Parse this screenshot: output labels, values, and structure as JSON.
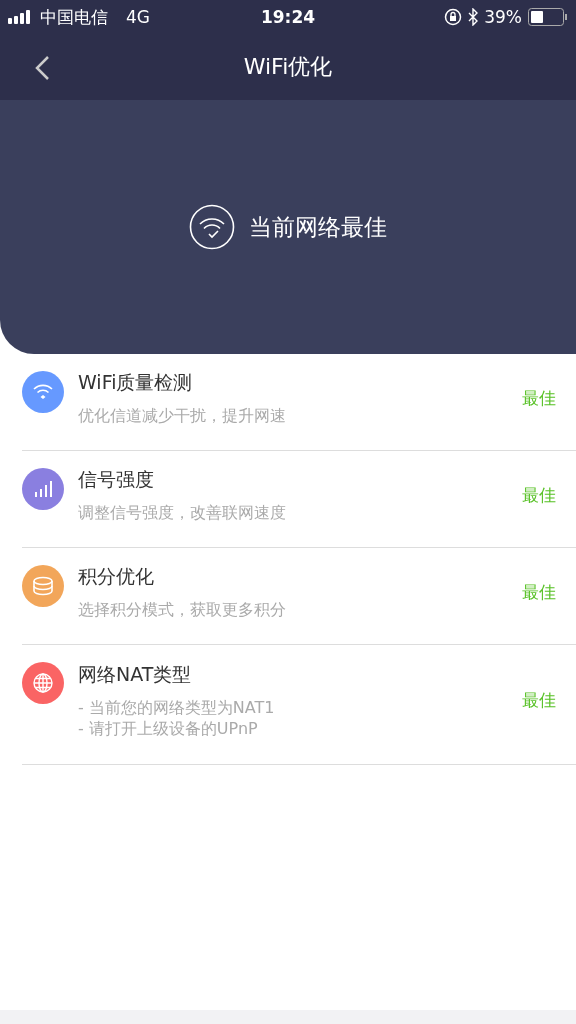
{
  "status_bar": {
    "carrier": "中国电信",
    "network": "4G",
    "time": "19:24",
    "battery": "39%"
  },
  "nav": {
    "title": "WiFi优化"
  },
  "hero": {
    "message": "当前网络最佳"
  },
  "items": [
    {
      "kind": "wifi",
      "color": "#6699ff",
      "title": "WiFi质量检测",
      "lines": [
        "优化信道减少干扰，提升网速"
      ],
      "status": "最佳"
    },
    {
      "kind": "signal",
      "color": "#8a7fe0",
      "title": "信号强度",
      "lines": [
        "调整信号强度，改善联网速度"
      ],
      "status": "最佳"
    },
    {
      "kind": "coins",
      "color": "#f2a65a",
      "title": "积分优化",
      "lines": [
        "选择积分模式，获取更多积分"
      ],
      "status": "最佳"
    },
    {
      "kind": "globe",
      "color": "#fa6464",
      "title": "网络NAT类型",
      "lines": [
        "- 当前您的网络类型为NAT1",
        "- 请打开上级设备的UPnP"
      ],
      "status": "最佳"
    }
  ]
}
